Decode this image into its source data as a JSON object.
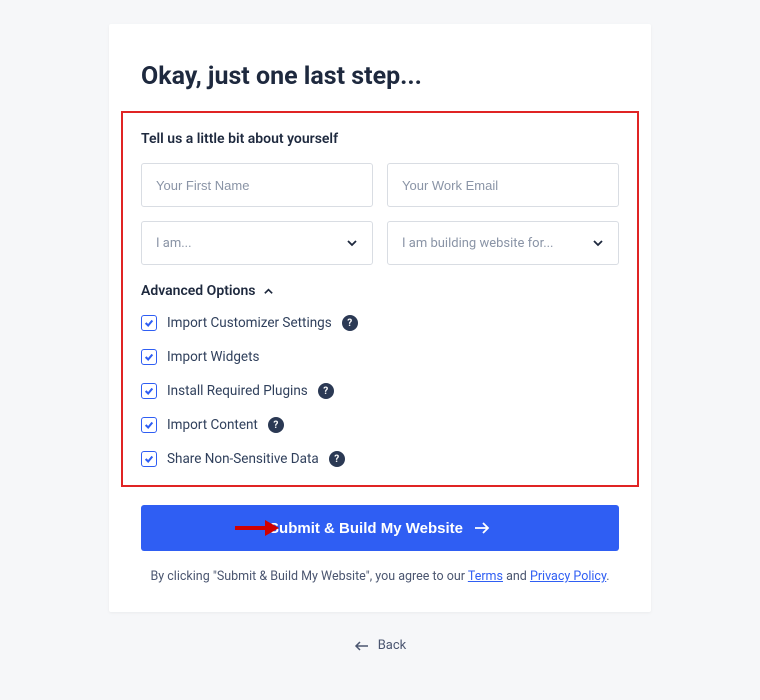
{
  "heading": "Okay, just one last step...",
  "form": {
    "subheading": "Tell us a little bit about yourself",
    "first_name_placeholder": "Your First Name",
    "email_placeholder": "Your Work Email",
    "role_placeholder": "I am...",
    "building_for_placeholder": "I am building website for..."
  },
  "advanced": {
    "header": "Advanced Options",
    "options": [
      {
        "label": "Import Customizer Settings",
        "help": true
      },
      {
        "label": "Import Widgets",
        "help": false
      },
      {
        "label": "Install Required Plugins",
        "help": true
      },
      {
        "label": "Import Content",
        "help": true
      },
      {
        "label": "Share Non-Sensitive Data",
        "help": true
      }
    ]
  },
  "submit_label": "Submit & Build My Website",
  "agree": {
    "prefix": "By clicking \"Submit & Build My Website\", you agree to our ",
    "terms": "Terms",
    "and": " and ",
    "privacy": "Privacy Policy",
    "suffix": "."
  },
  "back_label": "Back"
}
